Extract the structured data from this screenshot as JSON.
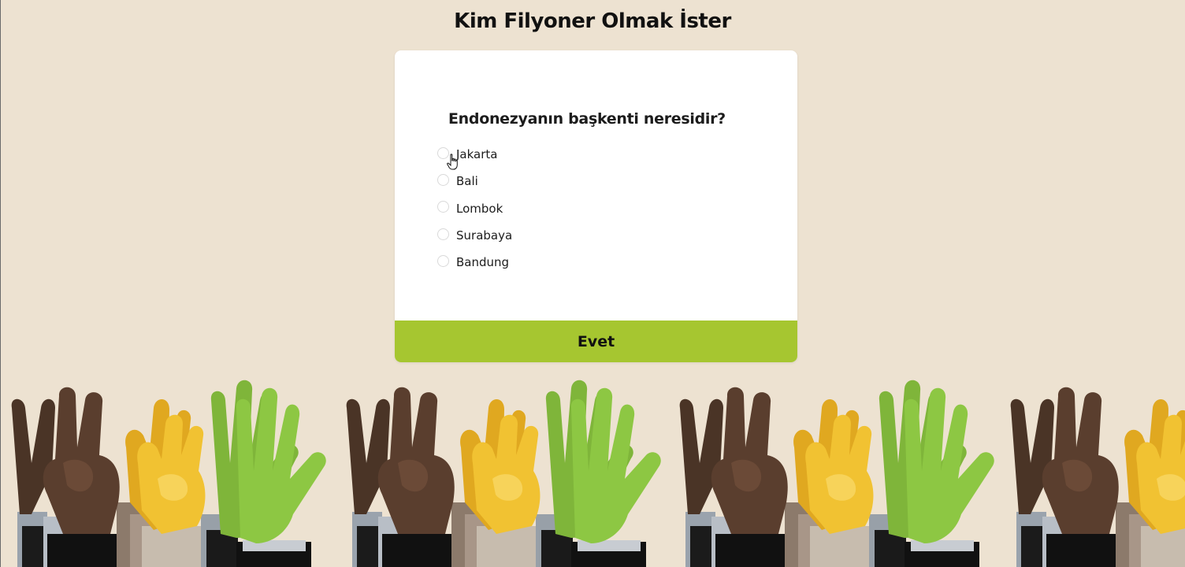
{
  "header": {
    "title": "Kim Filyoner Olmak İster"
  },
  "quiz": {
    "question": "Endonezyanın başkenti neresidir?",
    "options": [
      {
        "label": "Jakarta",
        "selected": false
      },
      {
        "label": "Bali",
        "selected": false
      },
      {
        "label": "Lombok",
        "selected": false
      },
      {
        "label": "Surabaya",
        "selected": false
      },
      {
        "label": "Bandung",
        "selected": false
      }
    ],
    "submit_label": "Evet"
  },
  "colors": {
    "background": "#ede2d1",
    "card": "#ffffff",
    "accent": "#a6c630",
    "hand_dark": "#5a3e2e",
    "hand_yellow": "#f1c232",
    "hand_green": "#8bc53f"
  },
  "decor": {
    "cursor_icon": "hand-pointer-icon",
    "illustration": "raised-hands-illustration"
  }
}
